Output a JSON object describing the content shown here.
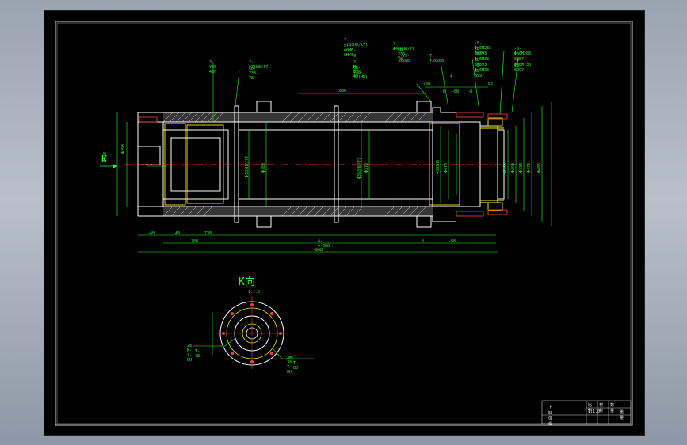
{
  "view": {
    "arrow_label": "K",
    "section_title": "K向",
    "section_scale": "1:1.0"
  },
  "callouts": {
    "top_left_1": "3-Y30-48F",
    "top_left_2": "2-Φ75H8/f7",
    "top_left_3": "CB-738-78",
    "top_mid_1": "7-Φ(83H8/k7)",
    "top_mid_2": "2-Φ0M6-6H/6g",
    "top_mid_3": "2-M-83-48",
    "top_mid_4": "CB-738-77(H8)",
    "top_c_1": "7-Φ438H8/f7",
    "top_c_2": "CB-738-78",
    "top_c_3": "2-Y3-3x288",
    "top_c_4": "7-Y3x288",
    "top_r_1": "-8-Φ-6M283-8-74",
    "top_r_2": "CB-38893",
    "top_r_3": "-8-Φ-6M38",
    "top_r_4": "CB-38893",
    "top_r_5": "-8-Φ-6M38",
    "top_r_6": "CB-8997",
    "top_rr_1": "-8-Φ-6M283",
    "top_rr_2": "CB-6787",
    "top_rr_3": "-8-Φ-6M738",
    "top_rr_4": "CB-8997",
    "bolt_label_1": "28-M-7-6H",
    "bolt_label_2": "T-78",
    "bolt_label_3": "3M-38-7-6H",
    "bolt_label_4": "T-88"
  },
  "dimensions": {
    "d_top_1": "888",
    "d_top_2": "738",
    "d_top_3": "-8",
    "d_top_4": "-88",
    "d_top_5": "-8",
    "d_top_6": "83",
    "d_top_7": "4",
    "d_bot_1": "-48",
    "d_bot_2": "48",
    "d_bot_3": "738",
    "d_bot_4": "788",
    "d_bot_5": "4-Φ-388",
    "d_bot_6": "8",
    "d_bot_7": "-88",
    "d_total": "-848",
    "dia_1": "Φ438",
    "dia_2": "Φ293",
    "dia_3": "Φ383H7/f7",
    "dia_4": "Φ383",
    "dia_5": "Φ383H8/f7",
    "dia_6": "Φ373",
    "dia_7": "Φ383H8",
    "dia_8": "Φ473",
    "dia_9": "Φ383",
    "dia_10": "Φ293",
    "dia_11": "Φ333",
    "dia_12": "Φ473",
    "dia_13": "Φ483"
  },
  "title_block": {
    "cell_1": "上缸体焊",
    "cell_2": "比例",
    "cell_3": "材料",
    "cell_4": "数量",
    "cell_5": "重量",
    "cell_6": "1:1.0"
  }
}
